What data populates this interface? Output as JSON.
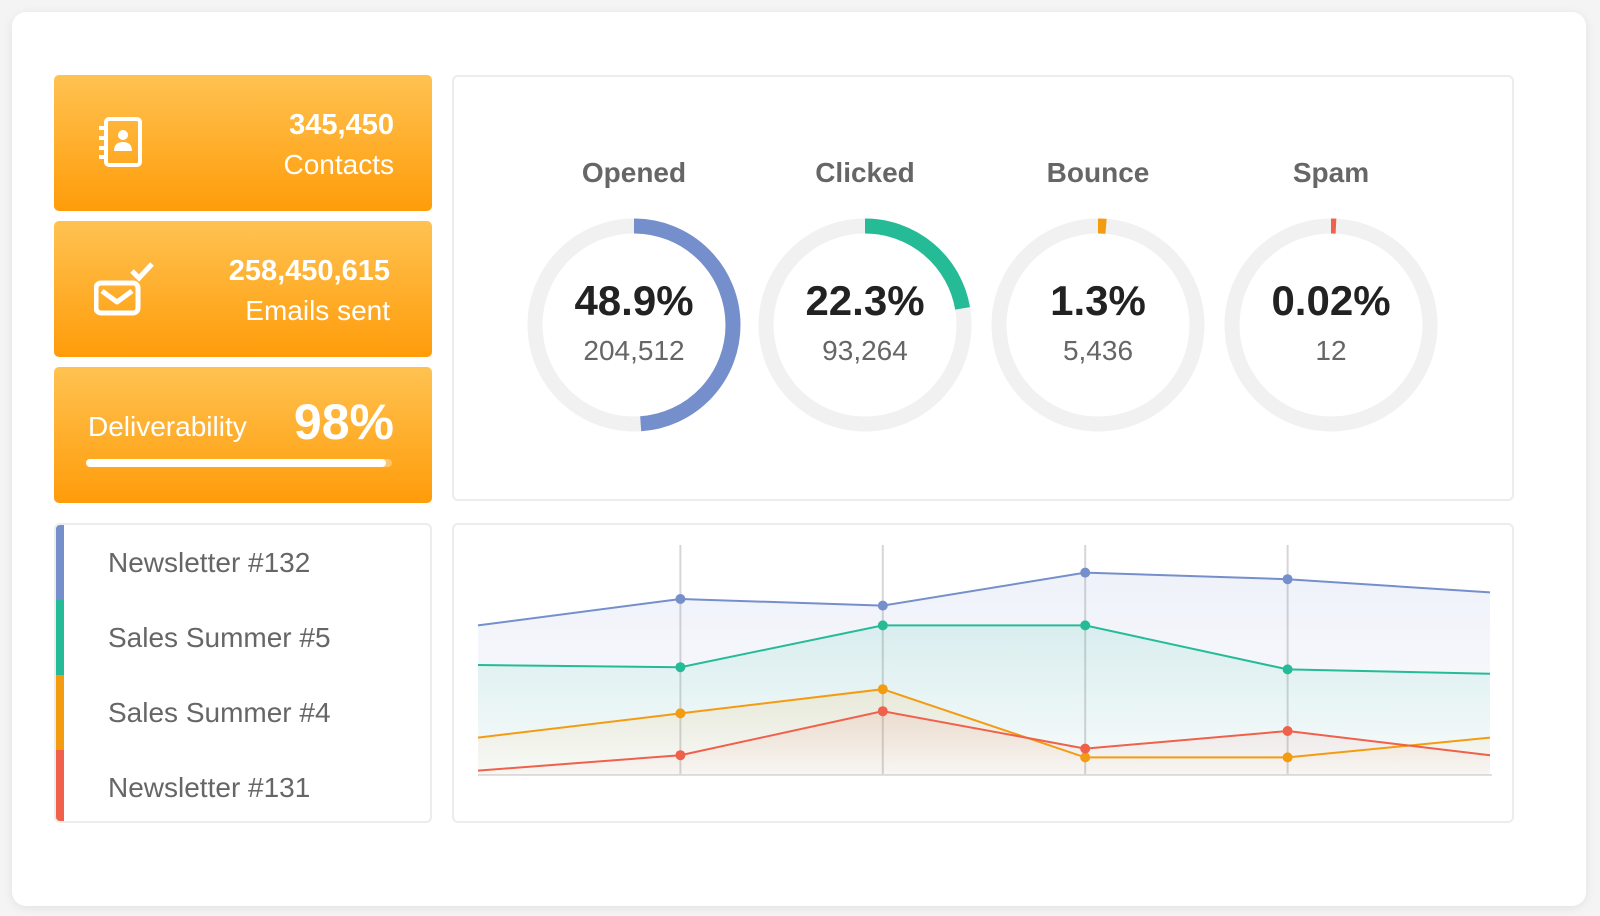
{
  "stats": {
    "contacts": {
      "value": "345,450",
      "label": "Contacts",
      "icon": "contacts-book-icon"
    },
    "emails": {
      "value": "258,450,615",
      "label": "Emails sent",
      "icon": "email-sent-check-icon"
    },
    "deliverability": {
      "label": "Deliverability",
      "value": "98%",
      "progress": 0.98
    }
  },
  "rings": [
    {
      "title": "Opened",
      "percent": "48.9%",
      "count": "204,512",
      "fraction": 0.489,
      "color": "#758fcc"
    },
    {
      "title": "Clicked",
      "percent": "22.3%",
      "count": "93,264",
      "fraction": 0.223,
      "color": "#26bb97"
    },
    {
      "title": "Bounce",
      "percent": "1.3%",
      "count": "5,436",
      "fraction": 0.013,
      "color": "#f39c12"
    },
    {
      "title": "Spam",
      "percent": "0.02%",
      "count": "12",
      "fraction": 0.0002,
      "color": "#f0604a"
    }
  ],
  "campaigns": [
    {
      "name": "Newsletter #132",
      "color": "#758fcc"
    },
    {
      "name": "Sales Summer #5",
      "color": "#26bb97"
    },
    {
      "name": "Sales Summer #4",
      "color": "#f39c12"
    },
    {
      "name": "Newsletter #131",
      "color": "#f0604a"
    }
  ],
  "chart_data": {
    "type": "area",
    "title": "",
    "xlabel": "",
    "ylabel": "",
    "x": [
      0,
      1,
      2,
      3,
      4,
      5
    ],
    "ylim": [
      0,
      100
    ],
    "grid": "vertical",
    "legend": "left-panel",
    "series": [
      {
        "name": "Newsletter #132",
        "color": "#758fcc",
        "values": [
          68,
          80,
          77,
          92,
          89,
          83
        ]
      },
      {
        "name": "Sales Summer #5",
        "color": "#26bb97",
        "values": [
          50,
          49,
          68,
          68,
          48,
          46
        ]
      },
      {
        "name": "Sales Summer #4",
        "color": "#f39c12",
        "values": [
          17,
          28,
          39,
          8,
          8,
          17
        ]
      },
      {
        "name": "Newsletter #131",
        "color": "#f0604a",
        "values": [
          2,
          9,
          29,
          12,
          20,
          9
        ]
      }
    ]
  }
}
